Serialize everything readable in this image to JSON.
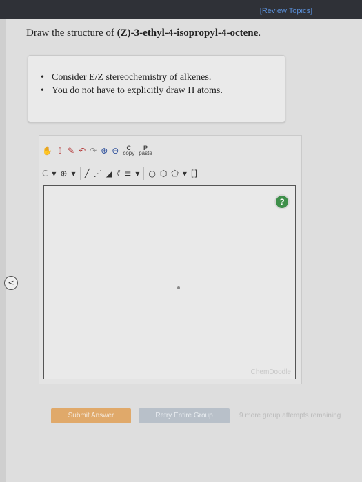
{
  "header": {
    "review_link": "[Review Topics]"
  },
  "sidebar": {
    "collapse_glyph": "<"
  },
  "question": {
    "prefix": "Draw the structure of ",
    "compound": "(Z)-3-ethyl-4-isopropyl-4-octene",
    "suffix": "."
  },
  "hints": [
    "Consider E/Z stereochemistry of alkenes.",
    "You do not have to explicitly draw H atoms."
  ],
  "editor": {
    "toolbar1": [
      {
        "name": "hand-tool-icon",
        "glyph": "✋",
        "tone": "red"
      },
      {
        "name": "upload-icon",
        "glyph": "⇧",
        "tone": "red"
      },
      {
        "name": "pencil-icon",
        "glyph": "✎",
        "tone": "red"
      },
      {
        "name": "undo-icon",
        "glyph": "↶",
        "tone": "red"
      },
      {
        "name": "redo-icon",
        "glyph": "↷",
        "tone": "gray"
      },
      {
        "name": "zoom-in-icon",
        "glyph": "⊕",
        "tone": "blue"
      },
      {
        "name": "zoom-out-icon",
        "glyph": "⊖",
        "tone": "blue"
      }
    ],
    "cp_buttons": [
      {
        "name": "c-copy-button",
        "top": "C",
        "bottom": "copy"
      },
      {
        "name": "p-paste-button",
        "top": "P",
        "bottom": "paste"
      }
    ],
    "toolbar2": [
      {
        "name": "carbon-element-icon",
        "glyph": "C",
        "tone": "gray"
      },
      {
        "name": "chevron-down-icon",
        "glyph": "▾",
        "tone": ""
      },
      {
        "name": "charge-plus-icon",
        "glyph": "⊕",
        "tone": ""
      },
      {
        "name": "chevron-down-icon",
        "glyph": "▾",
        "tone": ""
      },
      {
        "name": "sep",
        "glyph": "",
        "tone": ""
      },
      {
        "name": "single-bond-icon",
        "glyph": "╱",
        "tone": ""
      },
      {
        "name": "stereo-bond-icon",
        "glyph": "⋰",
        "tone": ""
      },
      {
        "name": "wedge-bond-icon",
        "glyph": "◢",
        "tone": ""
      },
      {
        "name": "double-bond-icon",
        "glyph": "⫽",
        "tone": ""
      },
      {
        "name": "triple-bond-icon",
        "glyph": "≡",
        "tone": ""
      },
      {
        "name": "chevron-down-icon",
        "glyph": "▾",
        "tone": ""
      },
      {
        "name": "sep",
        "glyph": "",
        "tone": ""
      },
      {
        "name": "cyclopropane-icon",
        "glyph": "○",
        "tone": ""
      },
      {
        "name": "benzene-icon",
        "glyph": "⬡",
        "tone": ""
      },
      {
        "name": "cyclopentane-icon",
        "glyph": "⬠",
        "tone": ""
      },
      {
        "name": "chevron-down-icon",
        "glyph": "▾",
        "tone": ""
      },
      {
        "name": "bracket-icon",
        "glyph": "[]",
        "tone": ""
      }
    ],
    "help_glyph": "?",
    "canvas_label": "ChemDoodle"
  },
  "actions": {
    "submit": "Submit Answer",
    "retry": "Retry Entire Group",
    "attempts": "9 more group attempts remaining"
  }
}
